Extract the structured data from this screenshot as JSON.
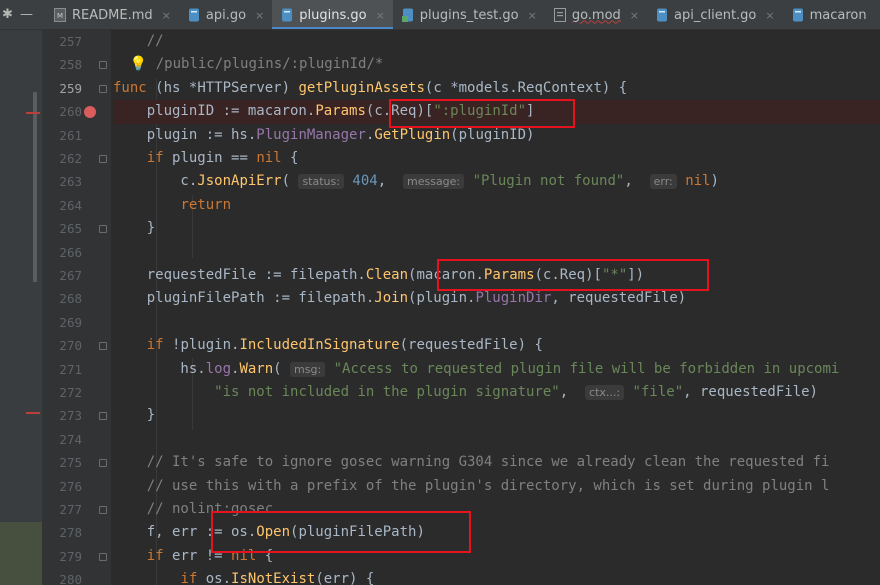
{
  "tabs": [
    {
      "label": "README.md",
      "icon": "markdown-file-icon",
      "active": false,
      "error": false
    },
    {
      "label": "api.go",
      "icon": "go-file-icon",
      "active": false,
      "error": false
    },
    {
      "label": "plugins.go",
      "icon": "go-file-icon",
      "active": true,
      "error": false
    },
    {
      "label": "plugins_test.go",
      "icon": "go-test-file-icon",
      "active": false,
      "error": false
    },
    {
      "label": "go.mod",
      "icon": "go-mod-file-icon",
      "active": false,
      "error": true
    },
    {
      "label": "api_client.go",
      "icon": "go-file-icon",
      "active": false,
      "error": false
    },
    {
      "label": "macaron",
      "icon": "go-file-icon",
      "active": false,
      "error": false
    }
  ],
  "tab_close_glyph": "×",
  "window_controls": {
    "settings": "✱",
    "minimize": "—"
  },
  "gutter": {
    "lines": [
      "257",
      "258",
      "259",
      "260",
      "261",
      "262",
      "263",
      "264",
      "265",
      "266",
      "267",
      "268",
      "269",
      "270",
      "271",
      "272",
      "273",
      "274",
      "275",
      "276",
      "277",
      "278",
      "279",
      "280"
    ],
    "current_line": "259",
    "breakpoint_line": "260"
  },
  "code": [
    [
      {
        "t": "    //",
        "c": "cm"
      }
    ],
    [
      {
        "t": "  ",
        "c": ""
      },
      {
        "t": "💡",
        "c": "bulb"
      },
      {
        "t": " /public/plugins/:pluginId/*",
        "c": "cm"
      }
    ],
    [
      {
        "t": "func ",
        "c": "kw"
      },
      {
        "t": "(hs *",
        "c": ""
      },
      {
        "t": "HTTPServer",
        "c": "type"
      },
      {
        "t": ") ",
        "c": ""
      },
      {
        "t": "getPluginAssets",
        "c": "fn"
      },
      {
        "t": "(c *models.ReqContext) {",
        "c": ""
      }
    ],
    [
      {
        "t": "    pluginID := ",
        "c": ""
      },
      {
        "t": "macaron",
        "c": ""
      },
      {
        "t": ".",
        "c": ""
      },
      {
        "t": "Params",
        "c": "method"
      },
      {
        "t": "(c.Req)[",
        "c": ""
      },
      {
        "t": "\":pluginId\"",
        "c": "str"
      },
      {
        "t": "]",
        "c": ""
      }
    ],
    [
      {
        "t": "    plugin := hs.",
        "c": ""
      },
      {
        "t": "PluginManager",
        "c": "field"
      },
      {
        "t": ".",
        "c": ""
      },
      {
        "t": "GetPlugin",
        "c": "method"
      },
      {
        "t": "(pluginID)",
        "c": ""
      }
    ],
    [
      {
        "t": "    ",
        "c": ""
      },
      {
        "t": "if ",
        "c": "kw"
      },
      {
        "t": "plugin == ",
        "c": ""
      },
      {
        "t": "nil",
        "c": "kw"
      },
      {
        "t": " {",
        "c": ""
      }
    ],
    [
      {
        "t": "        c.",
        "c": ""
      },
      {
        "t": "JsonApiErr",
        "c": "method"
      },
      {
        "t": "( ",
        "c": ""
      },
      {
        "t": "status:",
        "c": "hint"
      },
      {
        "t": " ",
        "c": ""
      },
      {
        "t": "404",
        "c": "num"
      },
      {
        "t": ",  ",
        "c": ""
      },
      {
        "t": "message:",
        "c": "hint"
      },
      {
        "t": " ",
        "c": ""
      },
      {
        "t": "\"Plugin not found\"",
        "c": "str"
      },
      {
        "t": ",  ",
        "c": ""
      },
      {
        "t": "err:",
        "c": "hint"
      },
      {
        "t": " ",
        "c": ""
      },
      {
        "t": "nil",
        "c": "kw"
      },
      {
        "t": ")",
        "c": ""
      }
    ],
    [
      {
        "t": "        ",
        "c": ""
      },
      {
        "t": "return",
        "c": "kw"
      }
    ],
    [
      {
        "t": "    }",
        "c": ""
      }
    ],
    [
      {
        "t": "",
        "c": ""
      }
    ],
    [
      {
        "t": "    requestedFile := filepath.",
        "c": ""
      },
      {
        "t": "Clean",
        "c": "method"
      },
      {
        "t": "(",
        "c": ""
      },
      {
        "t": "macaron",
        "c": ""
      },
      {
        "t": ".",
        "c": ""
      },
      {
        "t": "Params",
        "c": "method"
      },
      {
        "t": "(c.Req)[",
        "c": ""
      },
      {
        "t": "\"*\"",
        "c": "str"
      },
      {
        "t": "])",
        "c": ""
      }
    ],
    [
      {
        "t": "    pluginFilePath := filepath.",
        "c": ""
      },
      {
        "t": "Join",
        "c": "method"
      },
      {
        "t": "(plugin.",
        "c": ""
      },
      {
        "t": "PluginDir",
        "c": "field"
      },
      {
        "t": ", requestedFile)",
        "c": ""
      }
    ],
    [
      {
        "t": "",
        "c": ""
      }
    ],
    [
      {
        "t": "    ",
        "c": ""
      },
      {
        "t": "if ",
        "c": "kw"
      },
      {
        "t": "!plugin.",
        "c": ""
      },
      {
        "t": "IncludedInSignature",
        "c": "method"
      },
      {
        "t": "(requestedFile) {",
        "c": ""
      }
    ],
    [
      {
        "t": "        hs.",
        "c": ""
      },
      {
        "t": "log",
        "c": "field"
      },
      {
        "t": ".",
        "c": ""
      },
      {
        "t": "Warn",
        "c": "method"
      },
      {
        "t": "( ",
        "c": ""
      },
      {
        "t": "msg:",
        "c": "hint"
      },
      {
        "t": " ",
        "c": ""
      },
      {
        "t": "\"Access to requested plugin file will be forbidden in upcomi",
        "c": "str"
      }
    ],
    [
      {
        "t": "            ",
        "c": ""
      },
      {
        "t": "\"is not included in the plugin signature\"",
        "c": "str"
      },
      {
        "t": ",  ",
        "c": ""
      },
      {
        "t": "ctx...:",
        "c": "hint"
      },
      {
        "t": " ",
        "c": ""
      },
      {
        "t": "\"file\"",
        "c": "str"
      },
      {
        "t": ", requestedFile)",
        "c": ""
      }
    ],
    [
      {
        "t": "    }",
        "c": ""
      }
    ],
    [
      {
        "t": "",
        "c": ""
      }
    ],
    [
      {
        "t": "    // It's safe to ignore gosec warning G304 since we already clean the requested fi",
        "c": "cm"
      }
    ],
    [
      {
        "t": "    // use this with a prefix of the plugin's directory, which is set during plugin l",
        "c": "cm"
      }
    ],
    [
      {
        "t": "    // nolint:gosec",
        "c": "cm"
      }
    ],
    [
      {
        "t": "    f, err := os.",
        "c": ""
      },
      {
        "t": "Open",
        "c": "method"
      },
      {
        "t": "(pluginFilePath)",
        "c": ""
      }
    ],
    [
      {
        "t": "    ",
        "c": ""
      },
      {
        "t": "if ",
        "c": "kw"
      },
      {
        "t": "err != ",
        "c": ""
      },
      {
        "t": "nil",
        "c": "kw"
      },
      {
        "t": " {",
        "c": ""
      }
    ],
    [
      {
        "t": "        ",
        "c": ""
      },
      {
        "t": "if ",
        "c": "kw"
      },
      {
        "t": "os.",
        "c": ""
      },
      {
        "t": "IsNotExist",
        "c": "method"
      },
      {
        "t": "(err) {",
        "c": ""
      }
    ]
  ],
  "highlight_boxes": [
    {
      "name": "highlight-pluginid-param"
    },
    {
      "name": "highlight-wildcard-param"
    },
    {
      "name": "highlight-os-open"
    }
  ],
  "colors": {
    "background": "#2b2b2b",
    "keyword": "#cc7832",
    "function": "#ffc66d",
    "string": "#6a8759",
    "number": "#6897bb",
    "comment": "#808080",
    "field": "#9876aa",
    "breakpoint": "#db5c5c",
    "highlight_box": "#e8121e",
    "active_tab_underline": "#4a88c7"
  }
}
